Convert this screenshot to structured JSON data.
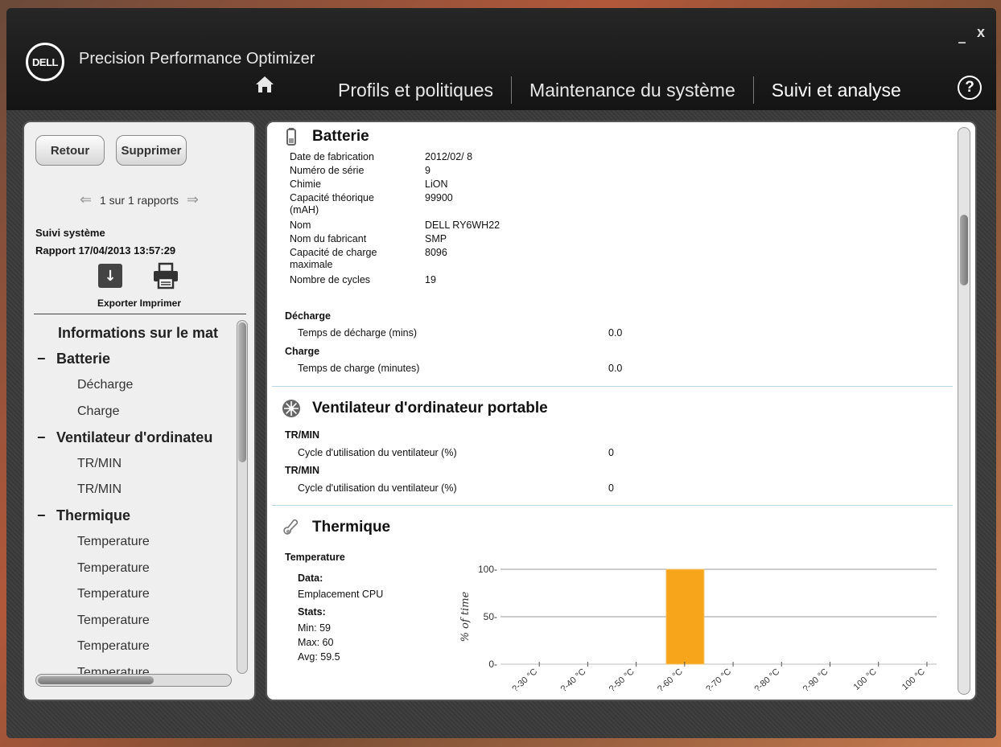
{
  "app": {
    "brand": "DELL",
    "title": "Precision Performance Optimizer",
    "minimize": "_",
    "close": "x",
    "help": "?"
  },
  "nav": {
    "items": [
      "Profils et politiques",
      "Maintenance du système",
      "Suivi et analyse"
    ],
    "active_index": 2
  },
  "left": {
    "back_label": "Retour",
    "delete_label": "Supprimer",
    "pager_text": "1 sur 1 rapports",
    "report_title": "Suivi système",
    "report_date": "Rapport 17/04/2013 13:57:29",
    "export_print_label": "Exporter Imprimer",
    "tree": [
      {
        "level": 0,
        "label": "Informations sur le mat"
      },
      {
        "level": 1,
        "label": "Batterie"
      },
      {
        "level": 2,
        "label": "Décharge"
      },
      {
        "level": 2,
        "label": "Charge"
      },
      {
        "level": 1,
        "label": "Ventilateur d'ordinateu"
      },
      {
        "level": 2,
        "label": "TR/MIN"
      },
      {
        "level": 2,
        "label": "TR/MIN"
      },
      {
        "level": 1,
        "label": "Thermique"
      },
      {
        "level": 2,
        "label": "Temperature"
      },
      {
        "level": 2,
        "label": "Temperature"
      },
      {
        "level": 2,
        "label": "Temperature"
      },
      {
        "level": 2,
        "label": "Temperature"
      },
      {
        "level": 2,
        "label": "Temperature"
      },
      {
        "level": 2,
        "label": "Temperature"
      }
    ]
  },
  "battery": {
    "title": "Batterie",
    "fields": [
      {
        "label": "Date de fabrication",
        "value": "2012/02/ 8"
      },
      {
        "label": "Numéro de série",
        "value": "9"
      },
      {
        "label": "Chimie",
        "value": "LiON"
      },
      {
        "label": "Capacité théorique",
        "label2": "(mAH)",
        "value": "99900"
      },
      {
        "label": "Nom",
        "value": "DELL RY6WH22"
      },
      {
        "label": "Nom du fabricant",
        "value": "SMP"
      },
      {
        "label": "Capacité de charge",
        "label2": "maximale",
        "value": "8096"
      },
      {
        "label": "Nombre de cycles",
        "value": "19"
      }
    ],
    "discharge_header": "Décharge",
    "discharge_label": "Temps de décharge (mins)",
    "discharge_value": "0.0",
    "charge_header": "Charge",
    "charge_label": "Temps de charge (minutes)",
    "charge_value": "0.0"
  },
  "fan": {
    "title": "Ventilateur d'ordinateur portable",
    "rows": [
      {
        "header": "TR/MIN",
        "label": "Cycle d'utilisation du ventilateur (%)",
        "value": "0"
      },
      {
        "header": "TR/MIN",
        "label": "Cycle d'utilisation du ventilateur (%)",
        "value": "0"
      }
    ]
  },
  "thermal": {
    "title": "Thermique",
    "temp_header": "Temperature",
    "data_label": "Data:",
    "location": "Emplacement  CPU",
    "stats_label": "Stats:",
    "min": "Min: 59",
    "max": "Max: 60",
    "avg": "Avg: 59.5"
  },
  "chart_data": {
    "type": "bar",
    "ylabel": "% of time",
    "ylim": [
      0,
      100
    ],
    "yticks": [
      0,
      50,
      100
    ],
    "categories": [
      "-30 °C",
      "-40 °C",
      "-50 °C",
      "-60 °C",
      "-70 °C",
      "-80 °C",
      "-90 °C",
      "100 °C",
      "100 °C"
    ],
    "tick_labels": [
      "?-30 °C",
      "?-40 °C",
      "?-50 °C",
      "?-60 °C",
      "?-70 °C",
      "?-80 °C",
      "?-90 °C",
      "100 °C",
      "100 °C"
    ],
    "values": [
      0,
      0,
      0,
      100,
      0,
      0,
      0,
      0,
      0
    ],
    "bar_color": "#f7a51b",
    "grid": true
  }
}
